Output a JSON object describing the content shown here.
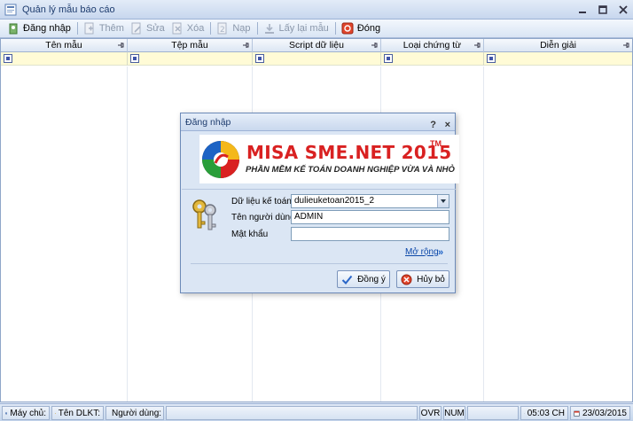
{
  "window": {
    "title": "Quản lý mẫu báo cáo"
  },
  "toolbar": {
    "items": [
      {
        "label": "Đăng nhập",
        "icon": "login-icon",
        "enabled": true
      },
      {
        "label": "Thêm",
        "icon": "add-icon",
        "enabled": false
      },
      {
        "label": "Sửa",
        "icon": "edit-icon",
        "enabled": false
      },
      {
        "label": "Xóa",
        "icon": "delete-icon",
        "enabled": false
      },
      {
        "label": "Nạp",
        "icon": "load-icon",
        "enabled": false
      },
      {
        "label": "Lấy lại mẫu",
        "icon": "restore-icon",
        "enabled": false
      },
      {
        "label": "Đóng",
        "icon": "close-icon",
        "enabled": true
      }
    ]
  },
  "grid": {
    "columns": [
      "Tên mẫu",
      "Tệp mẫu",
      "Script dữ liệu",
      "Loại chứng từ",
      "Diễn giải"
    ]
  },
  "dialog": {
    "title": "Đăng nhập",
    "help": "?",
    "close": "×",
    "brand": "MISA SME.NET 2015",
    "trademark": "TM",
    "tagline": "PHẦN MỀM KẾ TOÁN DOANH NGHIỆP VỪA VÀ NHỎ",
    "fields": {
      "database_label": "Dữ liệu kế toán",
      "database_value": "dulieuketoan2015_2",
      "username_label": "Tên người dùng",
      "username_value": "ADMIN",
      "password_label": "Mật khẩu",
      "password_value": ""
    },
    "more_label": "Mở rộng",
    "more_chevron": "»",
    "ok_label": "Đồng ý",
    "cancel_label": "Hủy bỏ"
  },
  "statusbar": {
    "machine": "Máy chủ:",
    "database": "Tên DLKT:",
    "user": "Người dùng:",
    "ovr": "OVR",
    "num": "NUM",
    "time": "05:03 CH",
    "date": "23/03/2015"
  },
  "colors": {
    "brand_red": "#d92121",
    "filter_row": "#fffbd6",
    "link_blue": "#0b47a8"
  }
}
